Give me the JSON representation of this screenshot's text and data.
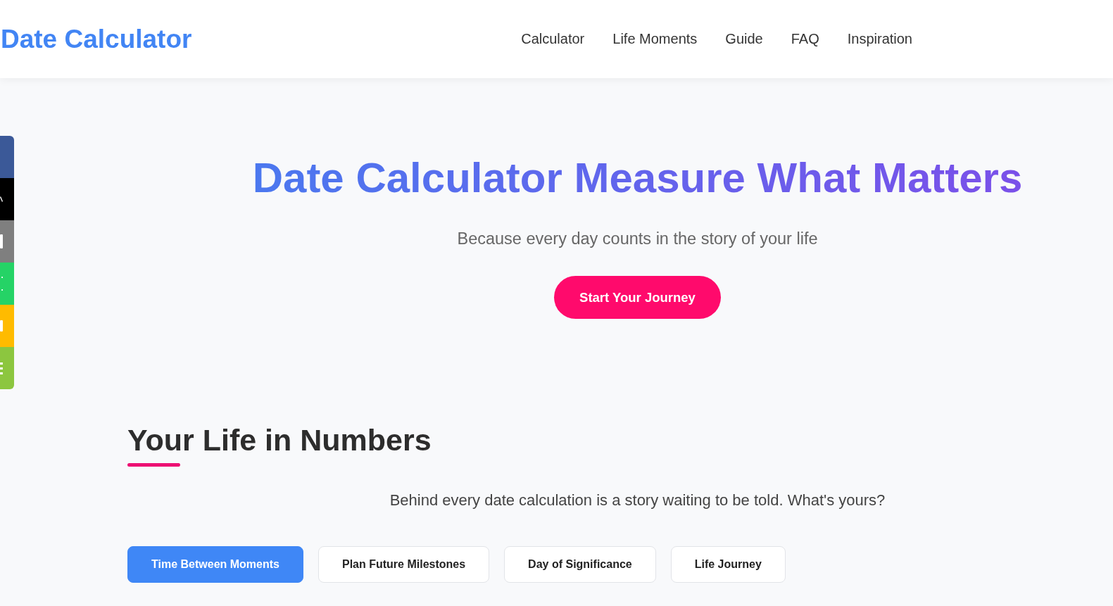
{
  "share_bar": {
    "buttons": [
      {
        "color": "#3b5998"
      },
      {
        "color": "#000000"
      },
      {
        "color": "#7f7f7f"
      },
      {
        "color": "#25d366"
      },
      {
        "color": "#ffbb00"
      },
      {
        "color": "#8cc63f"
      }
    ]
  },
  "header": {
    "logo": "Date Calculator",
    "nav": [
      "Calculator",
      "Life Moments",
      "Guide",
      "FAQ",
      "Inspiration"
    ]
  },
  "hero": {
    "title": "Date Calculator Measure What Matters",
    "subtitle": "Because every day counts in the story of your life",
    "button": "Start Your Journey"
  },
  "section": {
    "title": "Your Life in Numbers",
    "intro": "Behind every date calculation is a story waiting to be told. What's yours?",
    "tabs": [
      {
        "label": "Time Between Moments",
        "selected": true
      },
      {
        "label": "Plan Future Milestones",
        "selected": false
      },
      {
        "label": "Day of Significance",
        "selected": false
      },
      {
        "label": "Life Journey",
        "selected": false
      }
    ]
  }
}
